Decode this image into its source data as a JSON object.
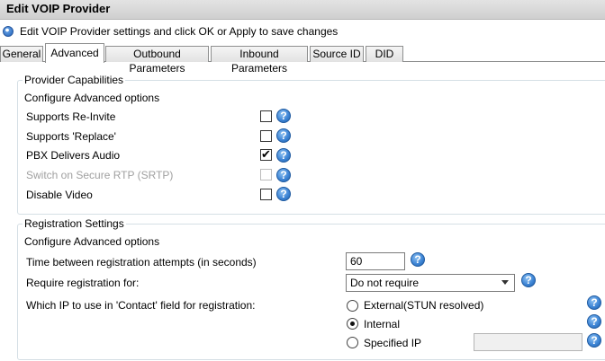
{
  "window": {
    "title": "Edit VOIP Provider"
  },
  "subheader": {
    "text": "Edit VOIP Provider settings and click OK or Apply to save changes"
  },
  "tabs": [
    {
      "label": "General"
    },
    {
      "label": "Advanced"
    },
    {
      "label": "Outbound Parameters"
    },
    {
      "label": "Inbound Parameters"
    },
    {
      "label": "Source ID"
    },
    {
      "label": "DID"
    }
  ],
  "capabilities": {
    "legend": "Provider Capabilities",
    "subtitle": "Configure Advanced options",
    "options": [
      {
        "label": "Supports Re-Invite",
        "checked": false,
        "enabled": true
      },
      {
        "label": "Supports 'Replace'",
        "checked": false,
        "enabled": true
      },
      {
        "label": "PBX Delivers Audio",
        "checked": true,
        "enabled": true
      },
      {
        "label": "Switch on Secure RTP (SRTP)",
        "checked": false,
        "enabled": false
      },
      {
        "label": "Disable Video",
        "checked": false,
        "enabled": true
      }
    ]
  },
  "registration": {
    "legend": "Registration Settings",
    "subtitle": "Configure Advanced options",
    "time_label": "Time between registration attempts (in seconds)",
    "time_value": "60",
    "require_label": "Require registration for:",
    "require_value": "Do not require",
    "contact_label": "Which IP to use in 'Contact' field for registration:",
    "contact_options": [
      {
        "label": "External(STUN resolved)",
        "selected": false
      },
      {
        "label": "Internal",
        "selected": true
      },
      {
        "label": "Specified IP",
        "selected": false
      }
    ],
    "specified_ip_value": ""
  },
  "check_mark": "✔"
}
